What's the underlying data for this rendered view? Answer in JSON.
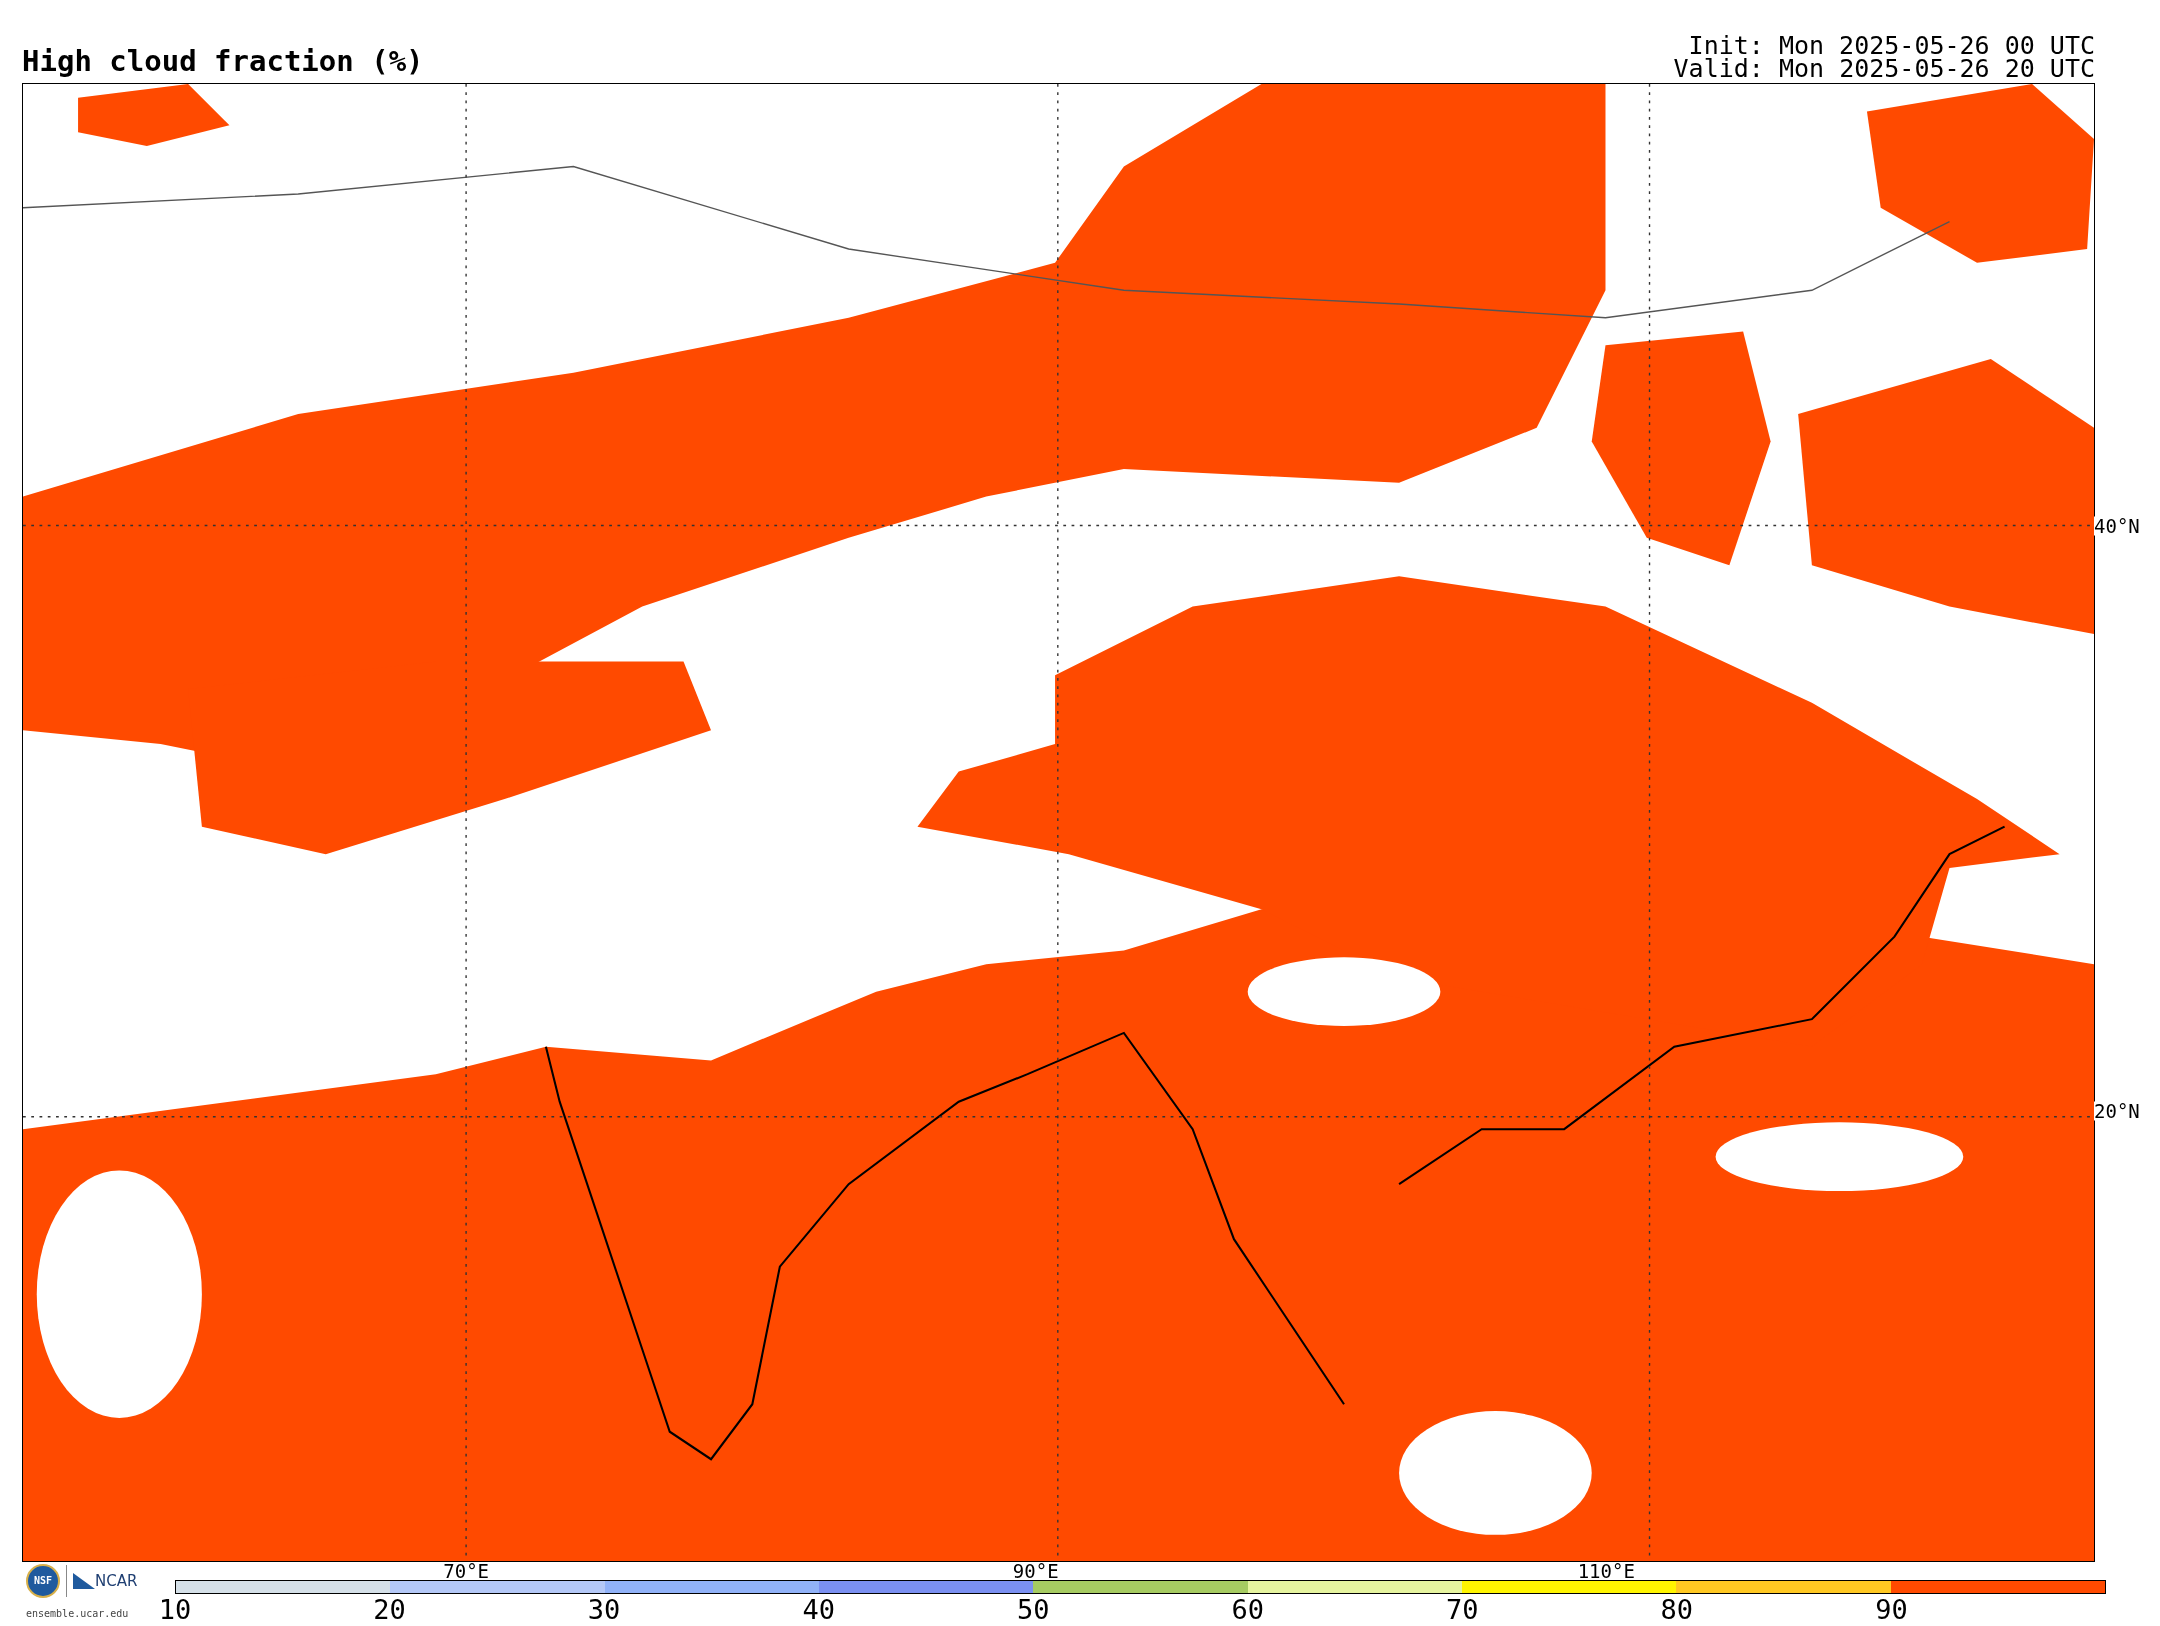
{
  "title": "High cloud fraction (%)",
  "init": "Init: Mon 2025-05-26 00 UTC",
  "valid": "Valid: Mon 2025-05-26 20 UTC",
  "map": {
    "lat_labels": [
      "40°N",
      "20°N"
    ],
    "lon_labels": [
      "70°E",
      "90°E",
      "110°E"
    ]
  },
  "colorbar": {
    "bins": [
      {
        "label": "10",
        "color": "#d5e0e8"
      },
      {
        "label": "20",
        "color": "#b4c8f7"
      },
      {
        "label": "30",
        "color": "#91b2f8"
      },
      {
        "label": "40",
        "color": "#7b90f1"
      },
      {
        "label": "50",
        "color": "#a6cb62"
      },
      {
        "label": "60",
        "color": "#e6f49f"
      },
      {
        "label": "70",
        "color": "#fff500"
      },
      {
        "label": "80",
        "color": "#ffc822"
      },
      {
        "label": "90",
        "color": "#ff4a00"
      }
    ]
  },
  "footer": {
    "logo_left": "NSF",
    "logo_right": "NCAR",
    "site": "ensemble.ucar.edu"
  }
}
